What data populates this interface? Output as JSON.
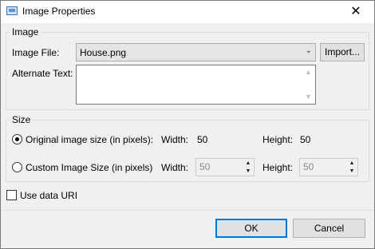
{
  "window": {
    "title": "Image Properties",
    "close_glyph": "✕"
  },
  "image_group": {
    "label": "Image",
    "file_label": "Image File:",
    "file_value": "House.png",
    "import_label": "Import...",
    "alt_label": "Alternate Text:",
    "alt_value": ""
  },
  "size_group": {
    "label": "Size",
    "original": {
      "label": "Original image size (in pixels):",
      "width_label": "Width:",
      "width": "50",
      "height_label": "Height:",
      "height": "50",
      "selected": true
    },
    "custom": {
      "label": "Custom Image Size (in pixels)",
      "width_label": "Width:",
      "width": "50",
      "height_label": "Height:",
      "height": "50",
      "selected": false
    }
  },
  "data_uri": {
    "label": "Use data URI",
    "checked": false
  },
  "footer": {
    "ok_label": "OK",
    "cancel_label": "Cancel"
  },
  "icons": {
    "dropdown": "chevron-down-icon",
    "spin_up": "spin-up-icon",
    "spin_down": "spin-down-icon"
  },
  "colors": {
    "accent": "#0078d7",
    "background": "#f0f0f0"
  }
}
